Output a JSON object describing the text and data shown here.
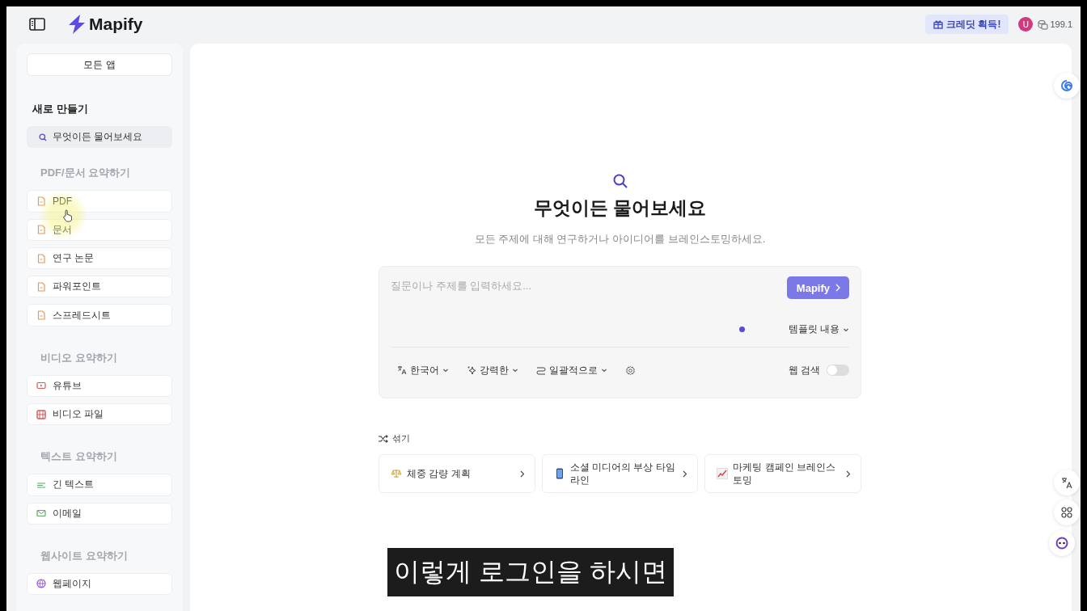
{
  "header": {
    "app_name": "Mapify",
    "credit_button": "크레딧 획득!",
    "avatar": "U",
    "credits": "199.1"
  },
  "sidebar": {
    "all_apps": "모든 앱",
    "new_heading": "새로 만들기",
    "ask_item": "무엇이든 물어보세요",
    "sections": [
      {
        "title": "PDF/문서 요약하기",
        "items": [
          {
            "label": "PDF",
            "kind": "file"
          },
          {
            "label": "문서",
            "kind": "file"
          },
          {
            "label": "연구 논문",
            "kind": "file"
          },
          {
            "label": "파워포인트",
            "kind": "file"
          },
          {
            "label": "스프레드시트",
            "kind": "file"
          }
        ]
      },
      {
        "title": "비디오 요약하기",
        "items": [
          {
            "label": "유튜브",
            "kind": "play"
          },
          {
            "label": "비디오 파일",
            "kind": "film"
          }
        ]
      },
      {
        "title": "텍스트 요약하기",
        "items": [
          {
            "label": "긴 텍스트",
            "kind": "lines"
          },
          {
            "label": "이메일",
            "kind": "mail"
          }
        ]
      },
      {
        "title": "웹사이트 요약하기",
        "items": [
          {
            "label": "웹페이지",
            "kind": "globe"
          }
        ]
      }
    ]
  },
  "main": {
    "title": "무엇이든 물어보세요",
    "subtitle": "모든 주제에 대해 연구하거나 아이디어를 브레인스토밍하세요.",
    "input": {
      "placeholder": "질문이나 주제를 입력하세요...",
      "submit": "Mapify",
      "template": "템플릿 내용",
      "options": [
        {
          "label": "한국어",
          "kind": "language"
        },
        {
          "label": "강력한",
          "kind": "sparkle"
        },
        {
          "label": "일괄적으로",
          "kind": "route"
        }
      ],
      "web_search": {
        "label": "웹 검색",
        "on": false
      }
    },
    "shuffle": "섞기",
    "suggestions": [
      {
        "label": "체중 감량 계획",
        "kind": "scale"
      },
      {
        "label": "소셜 미디어의 부상 타임라인",
        "kind": "phone"
      },
      {
        "label": "마케팅 캠페인 브레인스토밍",
        "kind": "chart"
      }
    ]
  },
  "caption": "이렇게 로그인을 하시면"
}
